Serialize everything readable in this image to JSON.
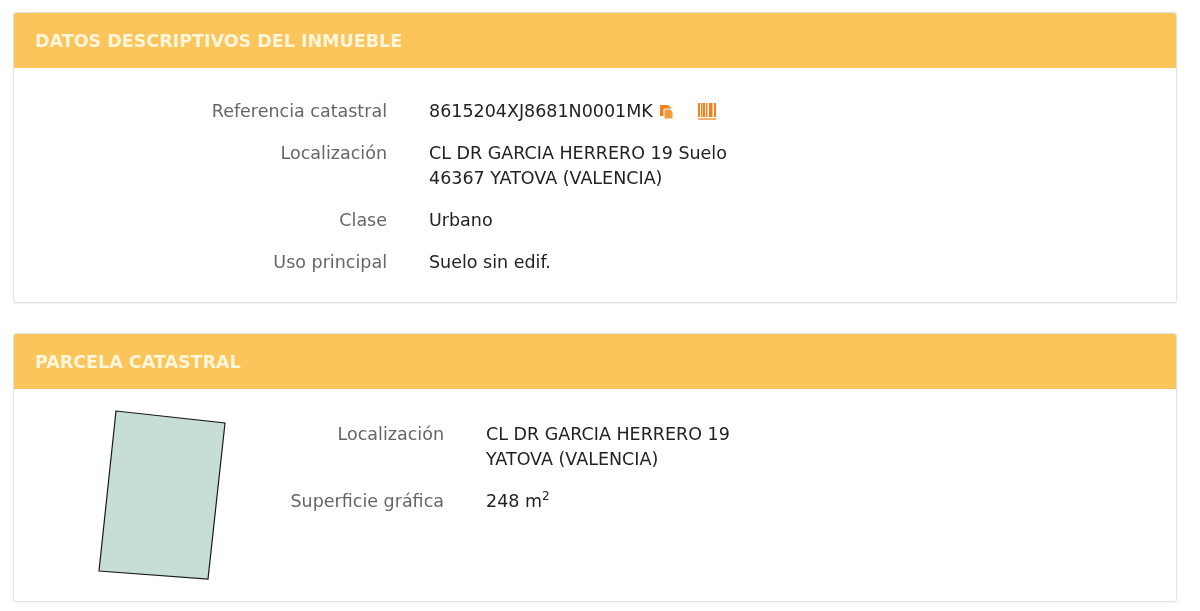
{
  "sections": [
    {
      "kind": "details",
      "title": "DATOS DESCRIPTIVOS DEL INMUEBLE",
      "fields": [
        {
          "kind": "reference",
          "label": "Referencia catastral",
          "lines": [
            "8615204XJ8681N0001MK"
          ]
        },
        {
          "kind": "text",
          "label": "Localización",
          "lines": [
            "CL DR GARCIA HERRERO 19 Suelo",
            "46367 YATOVA (VALENCIA)"
          ]
        },
        {
          "kind": "text",
          "label": "Clase",
          "lines": [
            "Urbano"
          ]
        },
        {
          "kind": "text",
          "label": "Uso principal",
          "lines": [
            "Suelo sin edif."
          ]
        }
      ]
    },
    {
      "kind": "parcel",
      "title": "PARCELA CATASTRAL",
      "fields": [
        {
          "kind": "text",
          "label": "Localización",
          "lines": [
            "CL DR GARCIA HERRERO 19",
            "YATOVA (VALENCIA)"
          ]
        },
        {
          "kind": "text",
          "label": "Superficie gráfica",
          "lines": [
            "248 m$^{2}$"
          ]
        }
      ]
    }
  ]
}
